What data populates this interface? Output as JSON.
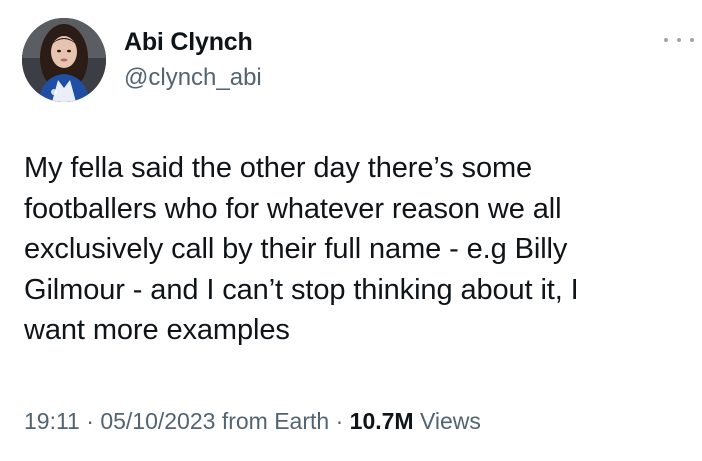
{
  "author": {
    "display_name": "Abi Clynch",
    "handle": "@clynch_abi"
  },
  "more_icon": "more-horizontal-icon",
  "tweet": {
    "text": "My fella said the other day there’s some\nfootballers who for whatever reason we all\nexclusively call by their full name - e.g Billy\nGilmour - and I can’t stop thinking about it, I\nwant more examples"
  },
  "meta": {
    "time": "19:11",
    "separator": " · ",
    "date": "05/10/2023",
    "source": " from Earth",
    "views_count": "10.7M",
    "views_label": " Views"
  },
  "colors": {
    "text": "#0f1419",
    "secondary": "#536471",
    "background": "#ffffff"
  }
}
